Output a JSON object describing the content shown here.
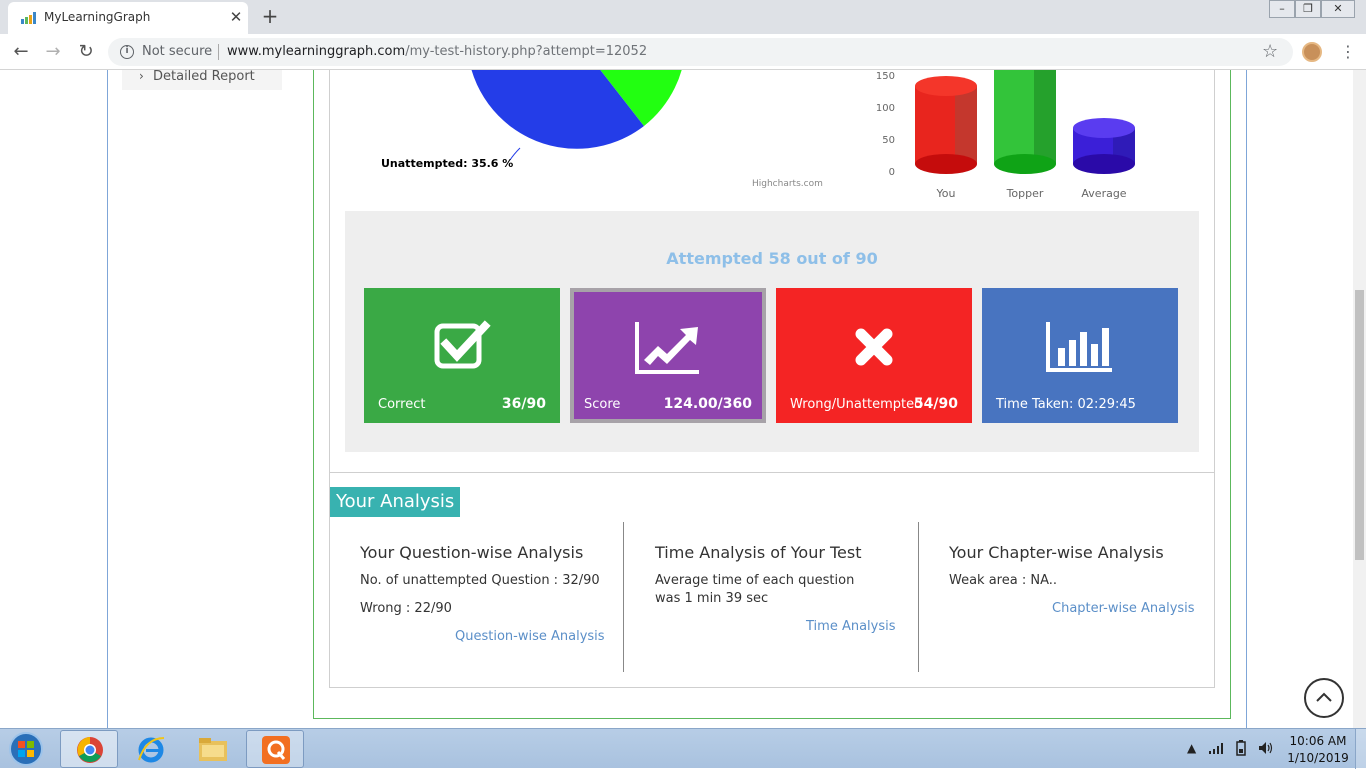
{
  "browser": {
    "tab_title": "MyLearningGraph",
    "tab_close": "✕",
    "new_tab": "+",
    "not_secure": "Not secure",
    "url_host": "www.mylearninggraph.com",
    "url_path": "/my-test-history.php?attempt=12052"
  },
  "sidebar": {
    "item_label": "Detailed Report"
  },
  "pie": {
    "label": "Unattempted: 35.6 %",
    "credit": "Highcharts.com"
  },
  "chart_data": [
    {
      "type": "pie",
      "categories": [
        "Unattempted",
        "Correct"
      ],
      "values": [
        35.6,
        40.0
      ],
      "colors": [
        "#243de8",
        "#22ff11"
      ],
      "note_visible_label": "Unattempted: 35.6 %"
    },
    {
      "type": "bar",
      "categories": [
        "You",
        "Topper",
        "Average"
      ],
      "values": [
        124,
        160,
        64
      ],
      "colors": [
        "#e8251e",
        "#25c12c",
        "#3b1fd8"
      ],
      "ylim": [
        0,
        160
      ],
      "y_ticks": [
        "150",
        "100",
        "50",
        "0"
      ]
    }
  ],
  "summary": {
    "attempted": "Attempted 58 out of 90",
    "cards": [
      {
        "label": "Correct",
        "value": "36/90",
        "color": "#3aa945",
        "icon": "check-square-icon"
      },
      {
        "label": "Score",
        "value": "124.00/360",
        "color": "#8e44ad",
        "icon": "trend-chart-icon"
      },
      {
        "label": "Wrong/Unattempted",
        "value": "54/90",
        "color": "#f42424",
        "icon": "cross-icon"
      },
      {
        "label": "Time Taken: 02:29:45",
        "value": "",
        "color": "#4874c0",
        "icon": "bar-chart-icon"
      }
    ]
  },
  "analysis": {
    "header": "Your Analysis",
    "question": {
      "title": "Your Question-wise Analysis",
      "line1": "No. of unattempted Question : 32/90",
      "line2": "Wrong : 22/90",
      "link": "Question-wise Analysis"
    },
    "time": {
      "title": "Time Analysis of Your Test",
      "line1": "Average time of each question",
      "line2": "was 1 min 39 sec",
      "link": "Time Analysis"
    },
    "chapter": {
      "title": "Your Chapter-wise Analysis",
      "line1": "Weak area : NA..",
      "link": "Chapter-wise Analysis"
    }
  },
  "taskbar": {
    "time": "10:06 AM",
    "date": "1/10/2019"
  }
}
